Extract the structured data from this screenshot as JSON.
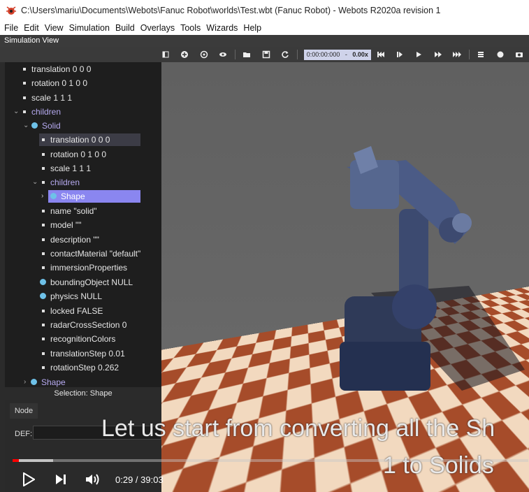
{
  "window": {
    "title": "C:\\Users\\mariu\\Documents\\Webots\\Fanuc Robot\\worlds\\Test.wbt (Fanuc Robot) - Webots R2020a revision 1"
  },
  "menu": [
    "File",
    "Edit",
    "View",
    "Simulation",
    "Build",
    "Overlays",
    "Tools",
    "Wizards",
    "Help"
  ],
  "panel": {
    "title": "Simulation View"
  },
  "toolbar": {
    "time": "0:00:00:000",
    "dash": "-",
    "speed": "0.00x"
  },
  "tree": [
    {
      "label": "translation 0 0 0",
      "kind": "bullet"
    },
    {
      "label": "rotation 0 1 0 0",
      "kind": "bullet"
    },
    {
      "label": "scale 1 1 1",
      "kind": "bullet"
    },
    {
      "label": "children",
      "kind": "bullet",
      "expanded": true,
      "color": "purple"
    },
    {
      "label": "Solid",
      "kind": "dot",
      "expanded": true,
      "color": "purple"
    },
    {
      "label": "translation 0 0 0",
      "kind": "bullet",
      "state": "hover"
    },
    {
      "label": "rotation 0 1 0 0",
      "kind": "bullet"
    },
    {
      "label": "scale 1 1 1",
      "kind": "bullet"
    },
    {
      "label": "children",
      "kind": "bullet",
      "expanded": true,
      "color": "purple"
    },
    {
      "label": "Shape",
      "kind": "dot",
      "collapsed": true,
      "state": "selected"
    },
    {
      "label": "name \"solid\"",
      "kind": "bullet"
    },
    {
      "label": "model \"\"",
      "kind": "bullet"
    },
    {
      "label": "description \"\"",
      "kind": "bullet"
    },
    {
      "label": "contactMaterial \"default\"",
      "kind": "bullet"
    },
    {
      "label": "immersionProperties",
      "kind": "bullet"
    },
    {
      "label": "boundingObject NULL",
      "kind": "dot"
    },
    {
      "label": "physics NULL",
      "kind": "dot"
    },
    {
      "label": "locked FALSE",
      "kind": "bullet"
    },
    {
      "label": "radarCrossSection 0",
      "kind": "bullet"
    },
    {
      "label": "recognitionColors",
      "kind": "bullet"
    },
    {
      "label": "translationStep 0.01",
      "kind": "bullet"
    },
    {
      "label": "rotationStep 0.262",
      "kind": "bullet"
    },
    {
      "label": "Shape",
      "kind": "dot",
      "collapsed": true,
      "color": "purple"
    }
  ],
  "selection": "Selection: Shape",
  "node_panel": {
    "tab": "Node",
    "def_label": "DEF:",
    "def_value": ""
  },
  "video": {
    "subtitle_line1": "Let us start from converting all the Sh",
    "subtitle_line2": "1 to Solids",
    "time": "0:29 / 39:03",
    "progress": 0.0124,
    "buffered": 0.0787
  },
  "colors": {
    "selection": "#8a86f0",
    "progress": "#ff0000",
    "tree_bg": "#1e1e1e",
    "floor_light": "#f2d9bf",
    "floor_dark": "#a64c2a"
  }
}
